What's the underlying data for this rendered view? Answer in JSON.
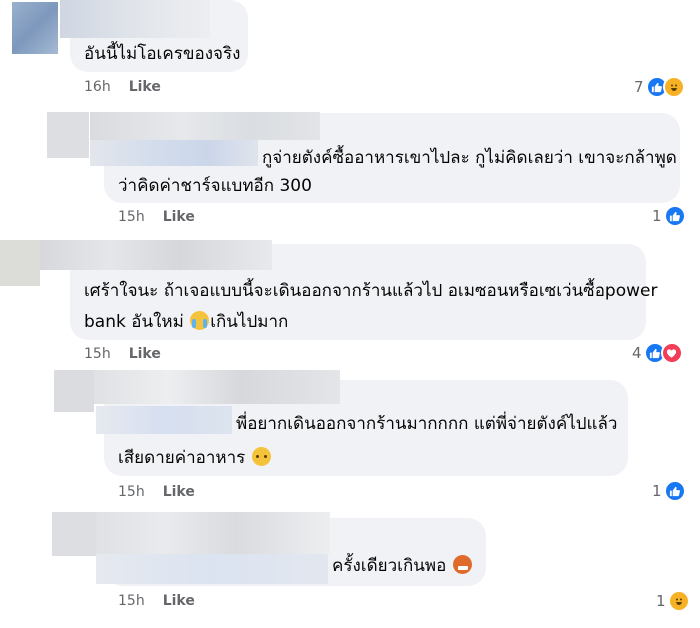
{
  "comments": [
    {
      "lines": [
        "อันนี้ไม่โอเครของจริง"
      ],
      "time": "16h",
      "like_label": "Like",
      "reaction_count": "7",
      "reactions": [
        "like-icon",
        "haha-icon"
      ]
    },
    {
      "lines": [
        "กูจ่ายตังค์ซื้ออาหารเขาไปละ กูไม่คิดเลยว่า เขาจะกล้าพูด",
        "ว่าคิดค่าชาร์จแบทอีก 300"
      ],
      "time": "15h",
      "like_label": "Like",
      "reaction_count": "1",
      "reactions": [
        "like-icon"
      ]
    },
    {
      "lines": [
        "เศร้าใจนะ ถ้าเจอแบบนี้จะเดินออกจากร้านแล้วไป อเมซอนหรือเซเว่นซื้อpower",
        "bank อันใหม่",
        "เกินไปมาก"
      ],
      "time": "15h",
      "like_label": "Like",
      "reaction_count": "4",
      "reactions": [
        "like-icon",
        "love-icon"
      ]
    },
    {
      "lines": [
        "พี่อยากเดินออกจากร้านมากกกก แต่พี่จ่ายตังค์ไปแล้ว",
        "เสียดายค่าอาหาร"
      ],
      "time": "15h",
      "like_label": "Like",
      "reaction_count": "1",
      "reactions": [
        "like-icon"
      ]
    },
    {
      "lines": [
        "ครั้งเดียวเกินพอ"
      ],
      "time": "15h",
      "like_label": "Like",
      "reaction_count": "1",
      "reactions": [
        "haha-icon"
      ]
    }
  ],
  "colors": {
    "bubble": "#f0f2f5",
    "like_blue": "#1877f2",
    "love_red": "#f33e58",
    "meta_gray": "#65676b"
  }
}
